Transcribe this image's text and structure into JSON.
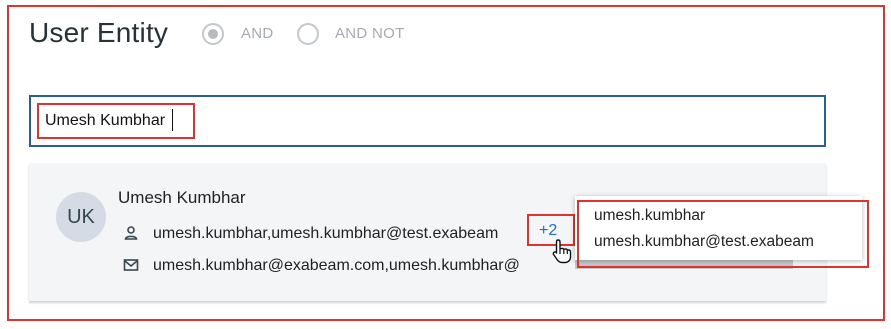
{
  "page": {
    "title": "User Entity"
  },
  "logic": {
    "options": [
      {
        "label": "AND",
        "selected": true
      },
      {
        "label": "AND NOT",
        "selected": false
      }
    ]
  },
  "search": {
    "value": "Umesh Kumbhar"
  },
  "result": {
    "initials": "UK",
    "name": "Umesh Kumbhar",
    "usernames_text": "umesh.kumbhar,umesh.kumbhar@test.exabeam",
    "more_count": "+2",
    "emails_text": "umesh.kumbhar@exabeam.com,umesh.kumbhar@",
    "user_icon": "user-icon",
    "email_icon": "email-icon"
  },
  "tooltip": {
    "items": [
      "umesh.kumbhar",
      "umesh.kumbhar@test.exabeam"
    ]
  },
  "colors": {
    "accent_blue": "#1f6fbf",
    "input_border": "#2b5f94",
    "highlight_red": "#e0322f"
  }
}
